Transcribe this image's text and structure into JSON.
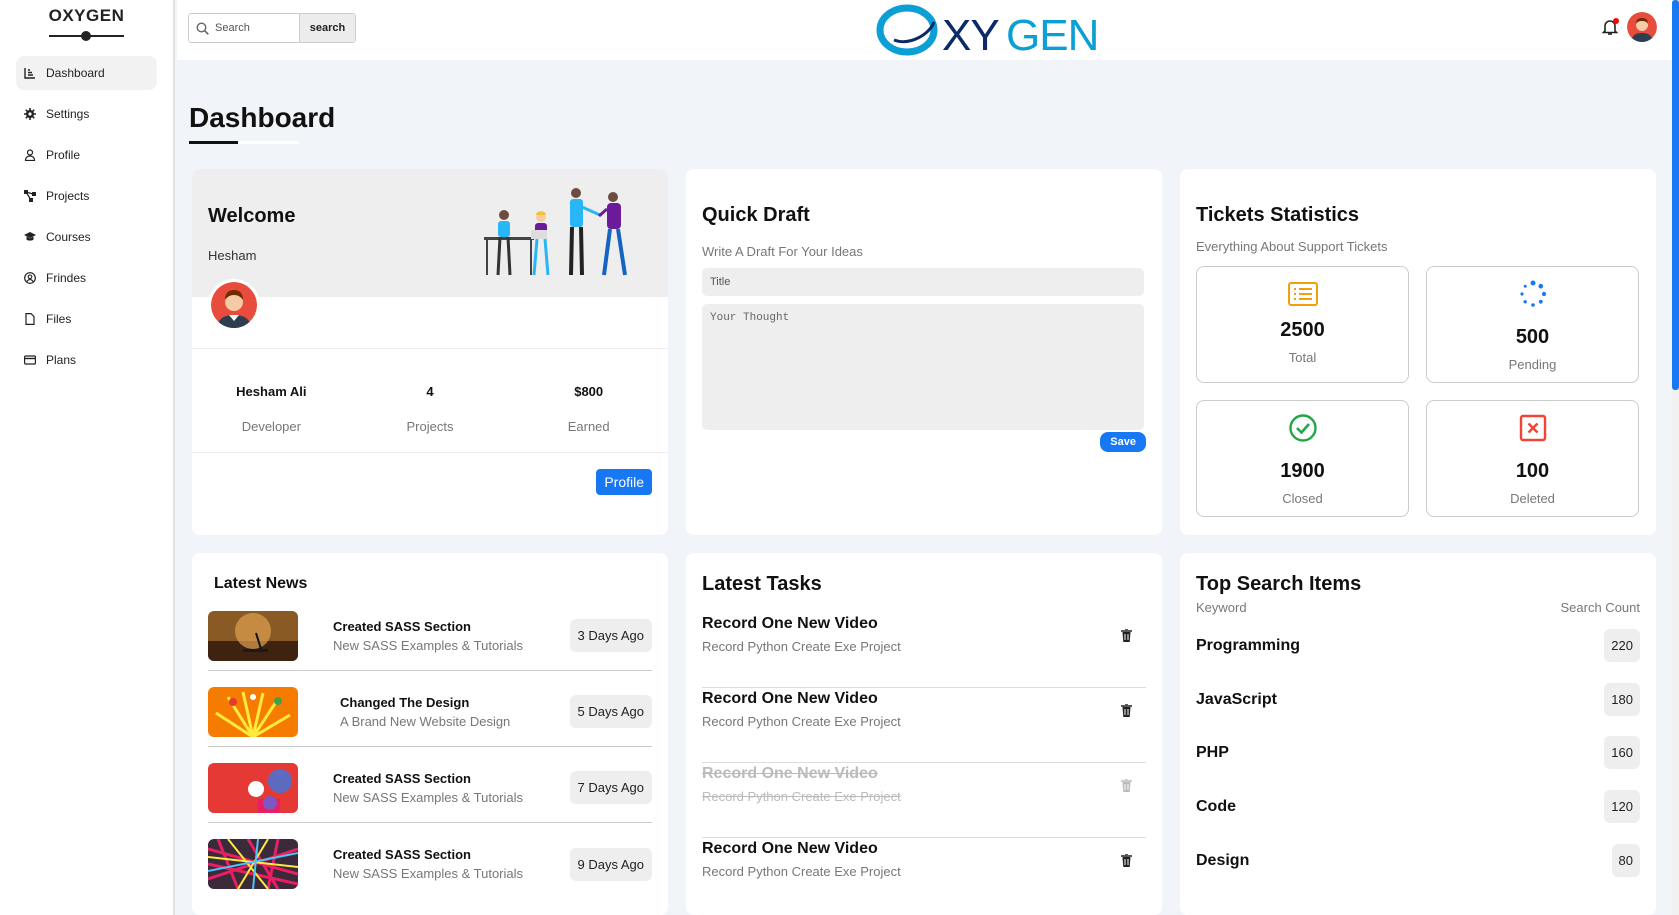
{
  "sidebar": {
    "brand": "OXYGEN",
    "items": [
      {
        "label": "Dashboard"
      },
      {
        "label": "Settings"
      },
      {
        "label": "Profile"
      },
      {
        "label": "Projects"
      },
      {
        "label": "Courses"
      },
      {
        "label": "Frindes"
      },
      {
        "label": "Files"
      },
      {
        "label": "Plans"
      }
    ]
  },
  "header": {
    "search_placeholder": "Search",
    "search_button": "search",
    "logo_text": "OXYGEN"
  },
  "page": {
    "title": "Dashboard"
  },
  "welcome": {
    "title": "Welcome",
    "user": "Hesham",
    "stats": [
      {
        "value": "Hesham Ali",
        "label": "Developer"
      },
      {
        "value": "4",
        "label": "Projects"
      },
      {
        "value": "$800",
        "label": "Earned"
      }
    ],
    "button": "Profile"
  },
  "draft": {
    "title": "Quick Draft",
    "subtitle": "Write A Draft For Your Ideas",
    "title_placeholder": "Title",
    "body_placeholder": "Your Thought",
    "button": "Save"
  },
  "tickets": {
    "title": "Tickets Statistics",
    "subtitle": "Everything About Support Tickets",
    "items": [
      {
        "value": "2500",
        "label": "Total",
        "icon": "list-icon",
        "color": "#f59e0b"
      },
      {
        "value": "500",
        "label": "Pending",
        "icon": "spinner-icon",
        "color": "#1877f2"
      },
      {
        "value": "1900",
        "label": "Closed",
        "icon": "check-circle-icon",
        "color": "#22a745"
      },
      {
        "value": "100",
        "label": "Deleted",
        "icon": "x-square-icon",
        "color": "#f44336"
      }
    ]
  },
  "news": {
    "title": "Latest News",
    "items": [
      {
        "title": "Created SASS Section",
        "desc": "New SASS Examples & Tutorials",
        "date": "3 Days Ago"
      },
      {
        "title": "Changed The Design",
        "desc": "A Brand New Website Design",
        "date": "5 Days Ago"
      },
      {
        "title": "Created SASS Section",
        "desc": "New SASS Examples & Tutorials",
        "date": "7 Days Ago"
      },
      {
        "title": "Created SASS Section",
        "desc": "New SASS Examples & Tutorials",
        "date": "9 Days Ago"
      }
    ]
  },
  "tasks": {
    "title": "Latest Tasks",
    "items": [
      {
        "title": "Record One New Video",
        "desc": "Record Python Create Exe Project",
        "done": false
      },
      {
        "title": "Record One New Video",
        "desc": "Record Python Create Exe Project",
        "done": false
      },
      {
        "title": "Record One New Video",
        "desc": "Record Python Create Exe Project",
        "done": true
      },
      {
        "title": "Record One New Video",
        "desc": "Record Python Create Exe Project",
        "done": false
      }
    ]
  },
  "top_search": {
    "title": "Top Search Items",
    "col_keyword": "Keyword",
    "col_count": "Search Count",
    "items": [
      {
        "keyword": "Programming",
        "count": "220"
      },
      {
        "keyword": "JavaScript",
        "count": "180"
      },
      {
        "keyword": "PHP",
        "count": "160"
      },
      {
        "keyword": "Code",
        "count": "120"
      },
      {
        "keyword": "Design",
        "count": "80"
      }
    ]
  },
  "colors": {
    "accent": "#1877f2",
    "background": "#f1f5f9"
  }
}
